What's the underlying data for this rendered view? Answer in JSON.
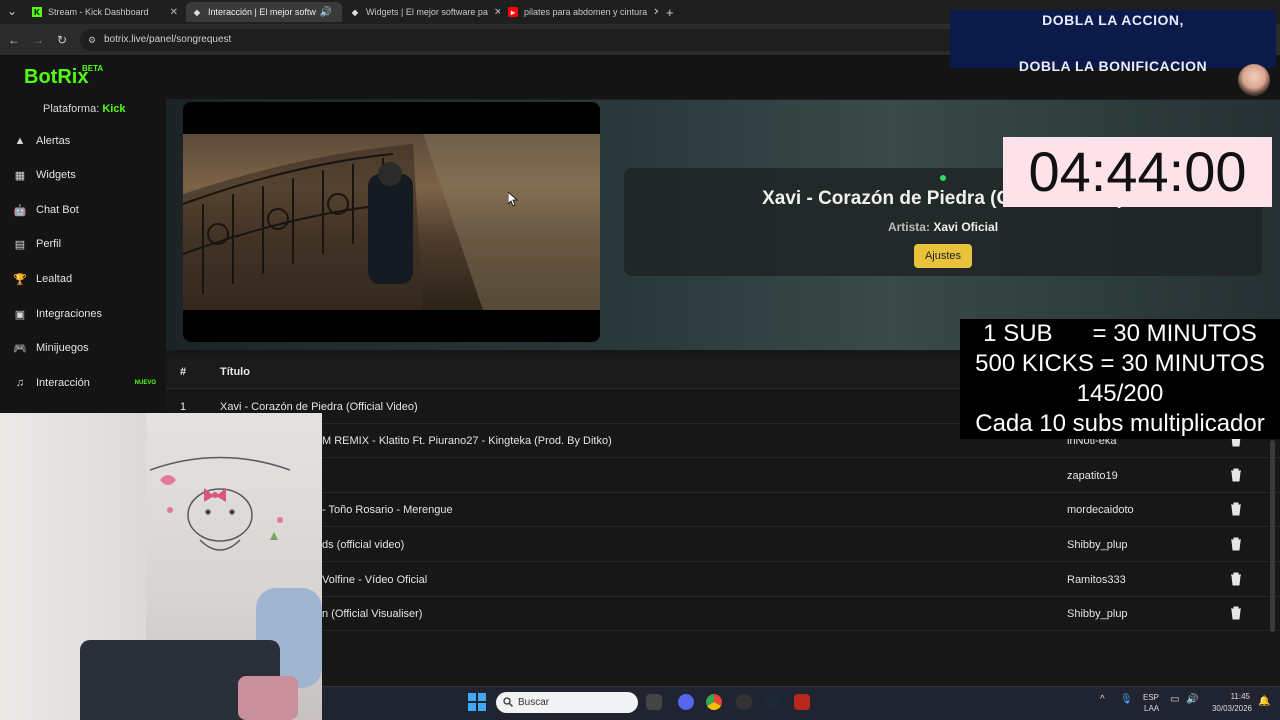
{
  "browser": {
    "tabs": [
      {
        "label": "Stream - Kick Dashboard"
      },
      {
        "label": "Interacción | El mejor softw"
      },
      {
        "label": "Widgets | El mejor software pa"
      },
      {
        "label": "pilates para abdomen y cintura"
      }
    ],
    "url": "botrix.live/panel/songrequest"
  },
  "brand": {
    "name": "BotRix",
    "beta": "BETA",
    "accent": "#53fc18"
  },
  "platform": {
    "label": "Plataforma:",
    "value": "Kick"
  },
  "sidebar": {
    "items": [
      {
        "label": "Alertas",
        "icon": "warning-icon"
      },
      {
        "label": "Widgets",
        "icon": "grid-icon"
      },
      {
        "label": "Chat Bot",
        "icon": "robot-icon"
      },
      {
        "label": "Perfil",
        "icon": "id-card-icon"
      },
      {
        "label": "Lealtad",
        "icon": "trophy-icon"
      },
      {
        "label": "Integraciones",
        "icon": "plug-icon"
      },
      {
        "label": "Minijuegos",
        "icon": "gamepad-icon"
      },
      {
        "label": "Interacción",
        "icon": "music-icon",
        "badge": "NUEVO"
      }
    ]
  },
  "now_playing": {
    "title": "Xavi - Corazón de Piedra (Official Video)",
    "artist_label": "Artista:",
    "artist": "Xavi Oficial",
    "settings_button": "Ajustes"
  },
  "queue": {
    "headers": {
      "num": "#",
      "title": "Título"
    },
    "rows": [
      {
        "num": "1",
        "title": "Xavi - Corazón de Piedra (Official Video)",
        "user": ""
      },
      {
        "num": "",
        "title": "M REMIX - Klatito Ft. Piurano27 - Kingteka (Prod. By Ditko)",
        "user": "lnNotl-eka"
      },
      {
        "num": "",
        "title": "",
        "user": "zapatito19"
      },
      {
        "num": "",
        "title": "- Toño Rosario - Merengue",
        "user": "mordecaidoto"
      },
      {
        "num": "",
        "title": "ds (official video)",
        "user": "Shibby_plup"
      },
      {
        "num": "",
        "title": "Volfine - Vídeo Oficial",
        "user": "Ramitos333"
      },
      {
        "num": "",
        "title": "n (Official Visualiser)",
        "user": "Shibby_plup"
      }
    ]
  },
  "overlay": {
    "promo_line1": "DOBLA LA ACCION,",
    "promo_line2": "DOBLA LA BONIFICACION",
    "timer": "04:44:00",
    "info_lines": [
      "1 SUB      = 30 MINUTOS",
      "500 KICKS = 30 MINUTOS",
      "145/200",
      "Cada 10 subs multiplicador"
    ]
  },
  "taskbar": {
    "search_placeholder": "Buscar",
    "lang1": "ESP",
    "lang2": "LAA",
    "time": "11:45",
    "date": "30/03/2026"
  }
}
